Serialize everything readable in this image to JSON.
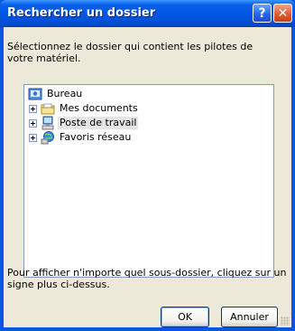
{
  "window": {
    "title": "Rechercher un dossier",
    "help_label": "?",
    "close_label": "✕"
  },
  "instruction": "Sélectionnez le dossier qui contient les pilotes de votre matériel.",
  "tree": {
    "items": [
      {
        "label": "Bureau",
        "icon": "desktop-icon",
        "expandable": false,
        "selected": false
      },
      {
        "label": "Mes documents",
        "icon": "folder-icon",
        "expandable": true,
        "selected": false
      },
      {
        "label": "Poste de travail",
        "icon": "computer-icon",
        "expandable": true,
        "selected": true
      },
      {
        "label": "Favoris réseau",
        "icon": "network-icon",
        "expandable": true,
        "selected": false
      }
    ]
  },
  "hint": "Pour afficher n'importe quel sous-dossier, cliquez sur un signe plus ci-dessus.",
  "buttons": {
    "ok": "OK",
    "cancel": "Annuler"
  },
  "colors": {
    "titlebar": "#0058e6",
    "client_bg": "#ece9d8",
    "tree_border": "#7f9db9",
    "selection": "#e5e5e5"
  }
}
